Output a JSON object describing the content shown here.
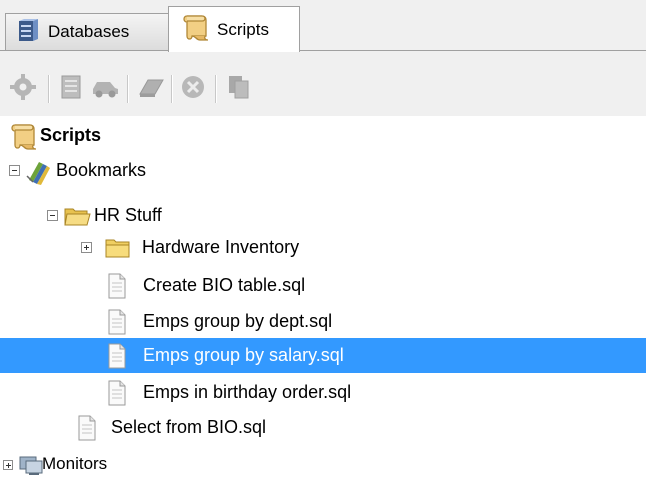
{
  "tabs": [
    {
      "label": "Databases",
      "icon": "database-icon",
      "active": false
    },
    {
      "label": "Scripts",
      "icon": "scroll-icon",
      "active": true
    }
  ],
  "toolbar": {
    "buttons": [
      "gear-icon",
      "properties-icon",
      "car-icon",
      "eraser-icon",
      "stop-icon",
      "copy-icon"
    ],
    "disabled": true
  },
  "tree": {
    "root": {
      "label": "Scripts",
      "icon": "scroll-icon"
    },
    "bookmarks": {
      "label": "Bookmarks",
      "icon": "bookmark-books-icon",
      "expanded": true
    },
    "hr_stuff": {
      "label": "HR Stuff",
      "icon": "folder-open-icon",
      "expanded": true
    },
    "hardware_inventory": {
      "label": "Hardware Inventory",
      "icon": "folder-icon",
      "expanded": false
    },
    "files": [
      "Create BIO table.sql",
      "Emps group by dept.sql",
      "Emps group by salary.sql",
      "Emps in birthday order.sql"
    ],
    "selected_file": "Emps group by salary.sql",
    "select_from_bio": "Select from BIO.sql",
    "monitors": {
      "label": "Monitors",
      "icon": "monitors-icon",
      "expanded": false
    }
  },
  "colors": {
    "selection": "#3399ff",
    "selection_text": "#ffffff",
    "chrome": "#f0f0f0"
  }
}
